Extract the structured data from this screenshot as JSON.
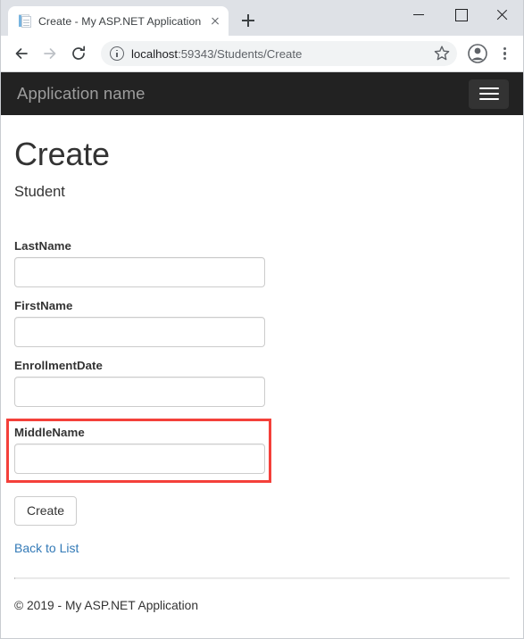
{
  "browser": {
    "tab": {
      "title": "Create - My ASP.NET Application",
      "favicon_name": "document-page-favicon",
      "close_label": "Close tab"
    },
    "new_tab_label": "New tab",
    "window_controls": {
      "minimize": "Minimize",
      "maximize": "Maximize",
      "close": "Close"
    },
    "nav": {
      "back": "Back",
      "forward": "Forward",
      "reload": "Reload"
    },
    "omnibox": {
      "site_info": "View site information",
      "url_host": "localhost",
      "url_rest": ":59343/Students/Create",
      "bookmark": "Bookmark this page"
    },
    "profile_label": "Profile",
    "menu_label": "Customize and control Google Chrome"
  },
  "page": {
    "navbar": {
      "brand": "Application name",
      "toggle_label": "Toggle navigation"
    },
    "title": "Create",
    "subtitle": "Student",
    "form": {
      "fields": [
        {
          "label": "LastName",
          "value": "",
          "placeholder": "",
          "highlighted": false
        },
        {
          "label": "FirstName",
          "value": "",
          "placeholder": "",
          "highlighted": false
        },
        {
          "label": "EnrollmentDate",
          "value": "",
          "placeholder": "",
          "highlighted": false
        },
        {
          "label": "MiddleName",
          "value": "",
          "placeholder": "",
          "highlighted": true
        }
      ],
      "submit_label": "Create",
      "back_link": "Back to List"
    },
    "footer": "© 2019 - My ASP.NET Application"
  },
  "colors": {
    "navbar_bg": "#222222",
    "brand_text": "#9d9d9d",
    "highlight_border": "#f4403a",
    "link": "#337ab7",
    "tabstrip_bg": "#dee1e6"
  }
}
